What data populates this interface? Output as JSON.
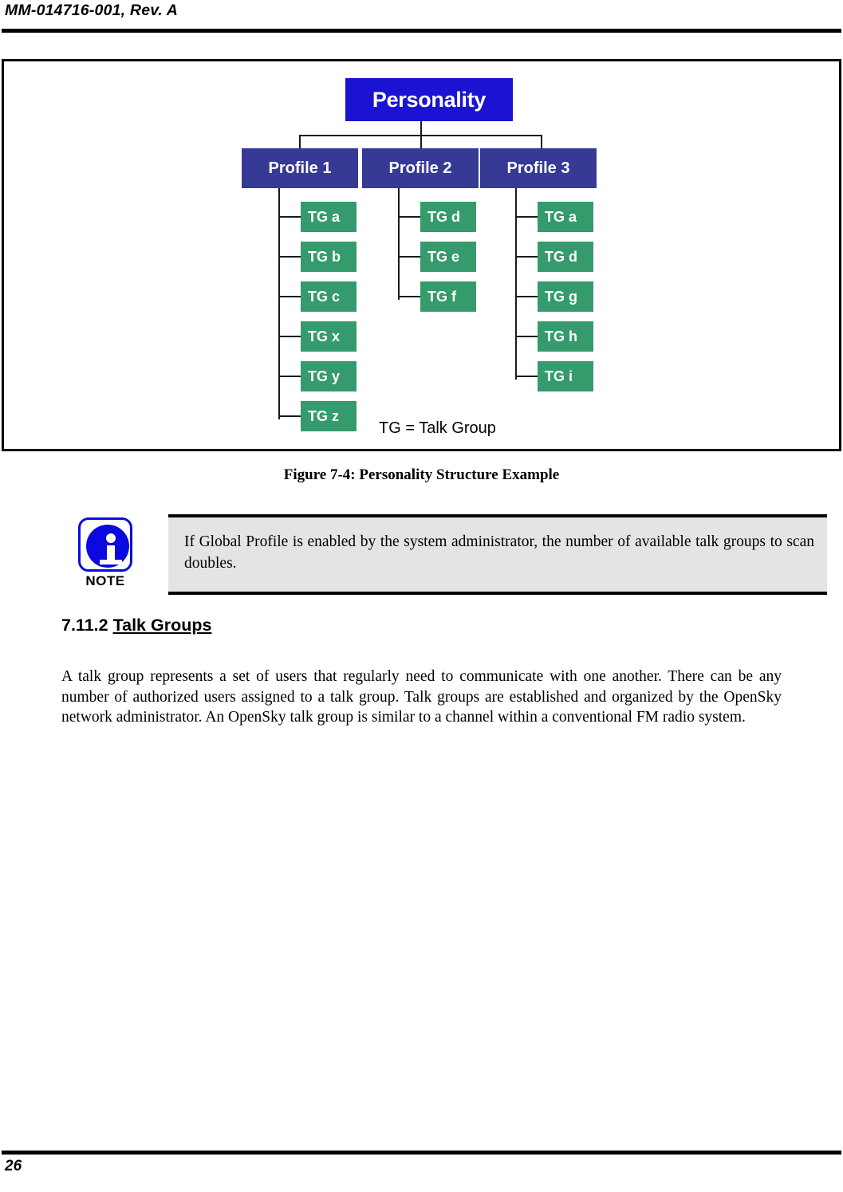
{
  "header": {
    "document_id": "MM-014716-001, Rev. A"
  },
  "figure": {
    "caption": "Figure 7-4: Personality Structure Example",
    "legend": "TG = Talk Group",
    "colors": {
      "root_box": "#1a14d2",
      "profile_box": "#363a94",
      "talkgroup_box": "#359b6c",
      "connector": "#1a1a1a",
      "box_text": "#ffffff"
    },
    "root": {
      "label": "Personality"
    },
    "profiles": [
      {
        "label": "Profile 1",
        "talk_groups": [
          "TG a",
          "TG b",
          "TG c",
          "TG x",
          "TG y",
          "TG z"
        ]
      },
      {
        "label": "Profile 2",
        "talk_groups": [
          "TG d",
          "TG e",
          "TG f"
        ]
      },
      {
        "label": "Profile 3",
        "talk_groups": [
          "TG a",
          "TG d",
          "TG g",
          "TG h",
          "TG i"
        ]
      }
    ]
  },
  "note": {
    "icon_label": "NOTE",
    "text": "If Global Profile is enabled by the system administrator, the number of available talk groups to scan doubles.",
    "background": "#e4e4e4",
    "icon_color": "#0a0ae0"
  },
  "section": {
    "number": "7.11.2",
    "title": "Talk Groups",
    "paragraph": "A talk group represents a set of users that regularly need to communicate with one another. There can be any number of authorized users assigned to a talk group. Talk groups are established and organized by the OpenSky network administrator. An OpenSky talk group is similar to a channel within a conventional FM radio system."
  },
  "footer": {
    "page_number": "26"
  }
}
